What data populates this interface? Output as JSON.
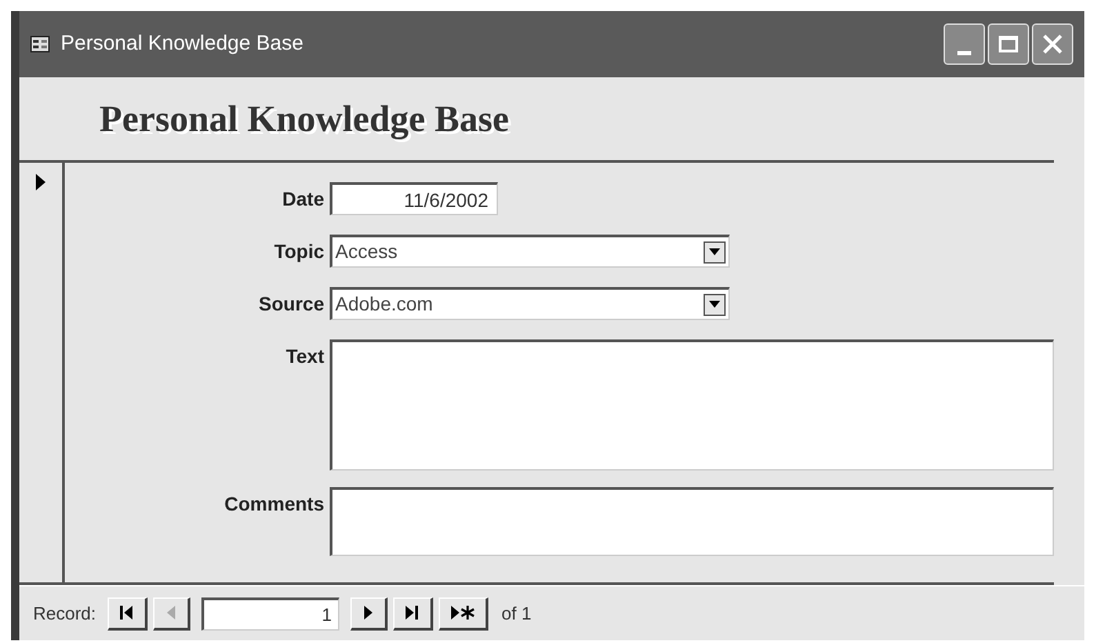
{
  "window": {
    "title": "Personal Knowledge Base"
  },
  "form": {
    "heading": "Personal Knowledge Base",
    "current_record": true,
    "fields": [
      {
        "kind": "text",
        "label": "Date",
        "value": "11/6/2002"
      },
      {
        "kind": "combo",
        "label": "Topic",
        "value": "Access"
      },
      {
        "kind": "combo",
        "label": "Source",
        "value": "Adobe.com"
      },
      {
        "kind": "memo",
        "label": "Text"
      },
      {
        "kind": "note",
        "label": "Comments"
      }
    ]
  },
  "navigation": {
    "label": "Record:",
    "record": "1",
    "of": "of 1",
    "buttons": [
      {
        "kind": "first",
        "disabled": false
      },
      {
        "kind": "prev",
        "disabled": true
      },
      {
        "kind": "field"
      },
      {
        "kind": "next",
        "disabled": false
      },
      {
        "kind": "last",
        "disabled": false
      },
      {
        "kind": "new",
        "disabled": false
      }
    ]
  }
}
